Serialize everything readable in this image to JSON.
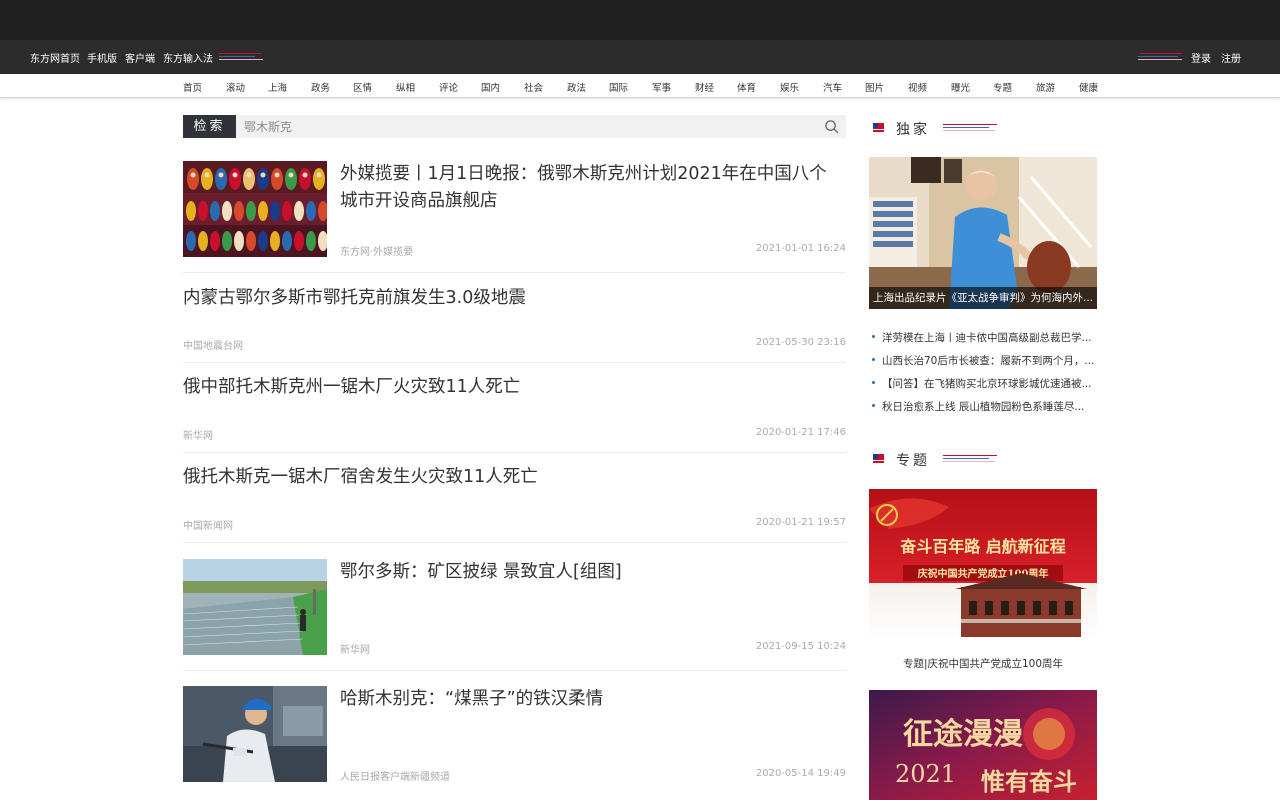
{
  "topbar": {
    "links": [
      "东方网首页",
      "手机版",
      "客户端",
      "东方输入法"
    ],
    "login": "登录",
    "register": "注册"
  },
  "nav": {
    "items": [
      "首页",
      "滚动",
      "上海",
      "政务",
      "区情",
      "纵相",
      "评论",
      "国内",
      "社会",
      "政法",
      "国际",
      "军事",
      "财经",
      "体育",
      "娱乐",
      "汽车",
      "图片",
      "视频",
      "曝光",
      "专题",
      "旅游",
      "健康"
    ]
  },
  "search": {
    "label": "检索",
    "value": "",
    "placeholder": "鄂木斯克"
  },
  "articles": [
    {
      "title": "外媒揽要丨1月1日晚报：俄鄂木斯克州计划2021年在中国八个城市开设商品旗舰店",
      "source": "东方网·外媒揽要",
      "time": "2021-01-01 16:24"
    },
    {
      "title": "内蒙古鄂尔多斯市鄂托克前旗发生3.0级地震",
      "source": "中国地震台网",
      "time": "2021-05-30 23:16"
    },
    {
      "title": "俄中部托木斯克州一锯木厂火灾致11人死亡",
      "source": "新华网",
      "time": "2020-01-21 17:46"
    },
    {
      "title": "俄托木斯克一锯木厂宿舍发生火灾致11人死亡",
      "source": "中国新闻网",
      "time": "2020-01-21 19:57"
    },
    {
      "title": "鄂尔多斯：矿区披绿 景致宜人[组图]",
      "source": "新华网",
      "time": "2021-09-15 10:24"
    },
    {
      "title": "哈斯木别克：“煤黑子”的铁汉柔情",
      "source": "人民日报客户端新疆频道",
      "time": "2020-05-14 19:49"
    }
  ],
  "sidebar": {
    "exclusive": {
      "heading": "独家",
      "feature_caption": "上海出品纪录片《亚太战争审判》为何海内外...",
      "list": [
        "洋劳模在上海丨迪卡侬中国高级副总裁巴学...",
        "山西长治70后市长被查：履新不到两个月，...",
        "【问答】在飞猪购买北京环球影城优速通被...",
        "秋日治愈系上线 辰山植物园粉色系睡莲尽..."
      ]
    },
    "topics": {
      "heading": "专题",
      "banner1_line1": "奋斗百年路 启航新征程",
      "banner1_line2": "庆祝中国共产党成立100周年",
      "banner1_caption": "专题|庆祝中国共产党成立100周年",
      "banner2_text1": "征途漫漫",
      "banner2_year": "2021",
      "banner2_text2": "惟有奋斗"
    }
  },
  "colors": {
    "top_black": "#202020",
    "top_bar": "#2c2c2c",
    "search_label_bg": "#2f3238",
    "accent_red": "#c8102e",
    "accent_blue": "#2a6fb7"
  }
}
